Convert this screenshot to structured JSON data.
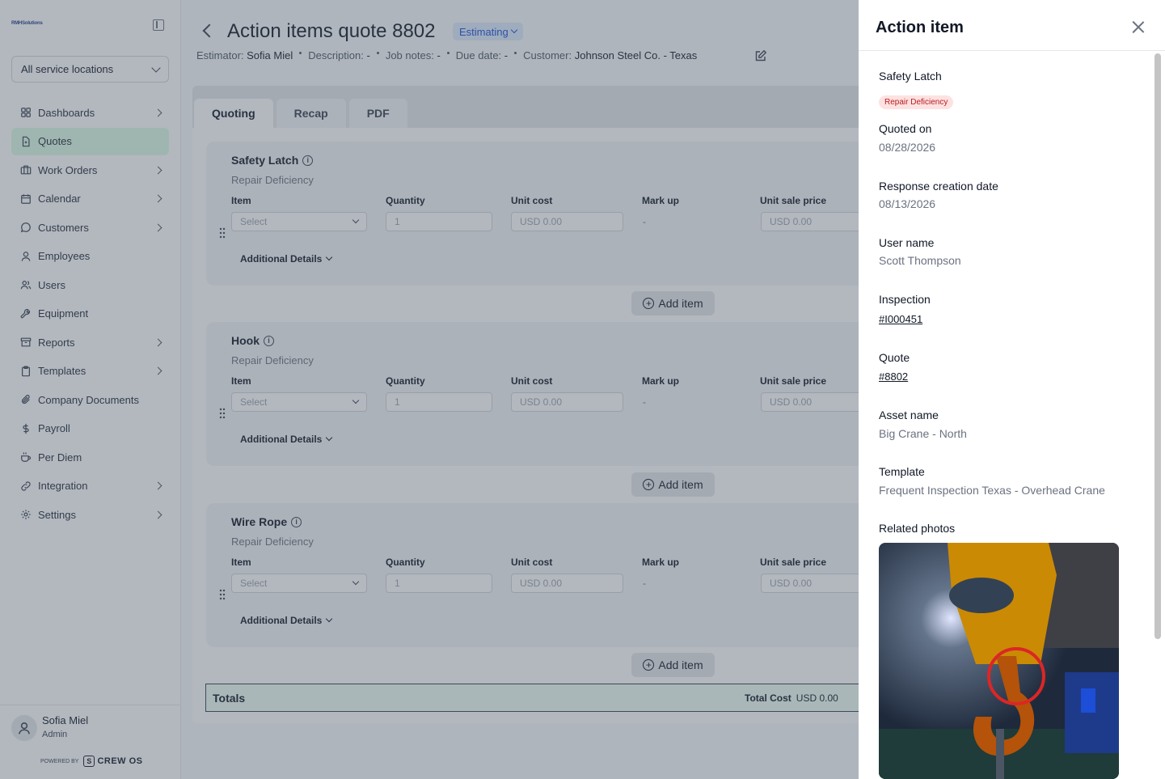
{
  "sidebar": {
    "logo_text": "RMHSolutions",
    "location_select": "All service locations",
    "items": [
      {
        "label": "Dashboards",
        "icon": "grid-icon",
        "has_children": true
      },
      {
        "label": "Quotes",
        "icon": "document-icon",
        "has_children": false,
        "active": true
      },
      {
        "label": "Work Orders",
        "icon": "briefcase-icon",
        "has_children": true
      },
      {
        "label": "Calendar",
        "icon": "calendar-icon",
        "has_children": true
      },
      {
        "label": "Customers",
        "icon": "chat-bubble-icon",
        "has_children": true
      },
      {
        "label": "Employees",
        "icon": "person-icon",
        "has_children": false
      },
      {
        "label": "Users",
        "icon": "people-icon",
        "has_children": false
      },
      {
        "label": "Equipment",
        "icon": "wrench-icon",
        "has_children": false
      },
      {
        "label": "Reports",
        "icon": "archive-icon",
        "has_children": true
      },
      {
        "label": "Templates",
        "icon": "clipboard-icon",
        "has_children": true
      },
      {
        "label": "Company Documents",
        "icon": "paperclip-icon",
        "has_children": false
      },
      {
        "label": "Payroll",
        "icon": "dollar-icon",
        "has_children": false
      },
      {
        "label": "Per Diem",
        "icon": "coffee-icon",
        "has_children": false
      },
      {
        "label": "Integration",
        "icon": "link-icon",
        "has_children": true
      },
      {
        "label": "Settings",
        "icon": "gear-icon",
        "has_children": true
      }
    ],
    "user": {
      "name": "Sofia Miel",
      "role": "Admin"
    },
    "powered_by": "POWERED BY",
    "brand": "CREW OS"
  },
  "header": {
    "title": "Action items quote 8802",
    "status": "Estimating",
    "meta": [
      {
        "label": "Estimator:",
        "value": "Sofia Miel"
      },
      {
        "label": "Description:",
        "value": "-"
      },
      {
        "label": "Job notes:",
        "value": "-"
      },
      {
        "label": "Due date:",
        "value": "-"
      },
      {
        "label": "Customer:",
        "value": "Johnson Steel Co. - Texas"
      }
    ]
  },
  "tabs": [
    "Quoting",
    "Recap",
    "PDF"
  ],
  "columns": {
    "item": "Item",
    "quantity": "Quantity",
    "unit_cost": "Unit cost",
    "mark_up": "Mark up",
    "unit_sale_price": "Unit sale price"
  },
  "cards": [
    {
      "title": "Safety Latch",
      "subtitle": "Repair Deficiency",
      "item_placeholder": "Select",
      "quantity": "1",
      "unit_cost": "USD 0.00",
      "mark_up": "-",
      "unit_sale_price": "USD 0.00",
      "additional": "Additional Details"
    },
    {
      "title": "Hook",
      "subtitle": "Repair Deficiency",
      "item_placeholder": "Select",
      "quantity": "1",
      "unit_cost": "USD 0.00",
      "mark_up": "-",
      "unit_sale_price": "USD 0.00",
      "additional": "Additional Details"
    },
    {
      "title": "Wire Rope",
      "subtitle": "Repair Deficiency",
      "item_placeholder": "Select",
      "quantity": "1",
      "unit_cost": "USD 0.00",
      "mark_up": "-",
      "unit_sale_price": "USD 0.00",
      "additional": "Additional Details"
    }
  ],
  "add_item_label": "Add item",
  "totals": {
    "label": "Totals",
    "total_cost_label": "Total Cost",
    "total_cost_value": "USD 0.00"
  },
  "drawer": {
    "title": "Action item",
    "item_name": "Safety Latch",
    "badge": "Repair Deficiency",
    "badge_color": "#b91c1c",
    "fields": {
      "quoted_on_label": "Quoted on",
      "quoted_on": "08/28/2026",
      "response_label": "Response creation date",
      "response": "08/13/2026",
      "user_label": "User name",
      "user": "Scott Thompson",
      "inspection_label": "Inspection",
      "inspection": "#I000451",
      "quote_label": "Quote",
      "quote": "#8802",
      "asset_label": "Asset name",
      "asset": "Big Crane - North",
      "template_label": "Template",
      "template": "Frequent Inspection Texas - Overhead Crane",
      "photos_label": "Related photos"
    }
  },
  "colors": {
    "accent": "#1d4ed8",
    "active_nav": "#dcfce7",
    "badge_bg": "#fee2e2"
  }
}
